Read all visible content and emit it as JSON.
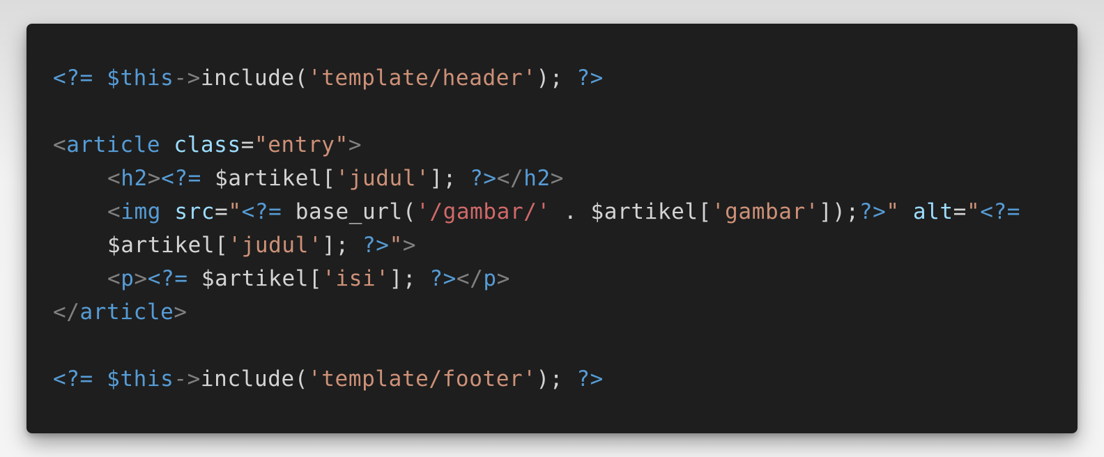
{
  "code_block": {
    "language": "php",
    "colors": {
      "background": "#1e1e1e",
      "keyword_tag": "#569cd6",
      "variable": "#9cdcfe",
      "string": "#ce9178",
      "punctuation": "#808080",
      "default": "#d4d4d4"
    },
    "lines": [
      {
        "indent": false,
        "tokens": [
          {
            "t": "<?=",
            "c": "phptag"
          },
          {
            "t": " ",
            "c": "default"
          },
          {
            "t": "$this",
            "c": "tag"
          },
          {
            "t": "->",
            "c": "punct"
          },
          {
            "t": "include(",
            "c": "default"
          },
          {
            "t": "'template/header'",
            "c": "str"
          },
          {
            "t": "); ",
            "c": "default"
          },
          {
            "t": "?>",
            "c": "phptag"
          }
        ]
      },
      {
        "indent": false,
        "tokens": []
      },
      {
        "indent": false,
        "tokens": [
          {
            "t": "<",
            "c": "punct"
          },
          {
            "t": "article",
            "c": "tag"
          },
          {
            "t": " ",
            "c": "default"
          },
          {
            "t": "class",
            "c": "attr"
          },
          {
            "t": "=",
            "c": "default"
          },
          {
            "t": "\"entry\"",
            "c": "str"
          },
          {
            "t": ">",
            "c": "punct"
          }
        ]
      },
      {
        "indent": true,
        "tokens": [
          {
            "t": "<",
            "c": "punct"
          },
          {
            "t": "h2",
            "c": "tag"
          },
          {
            "t": ">",
            "c": "punct"
          },
          {
            "t": "<?=",
            "c": "phptag"
          },
          {
            "t": " $artikel[",
            "c": "default"
          },
          {
            "t": "'judul'",
            "c": "str"
          },
          {
            "t": "]; ",
            "c": "default"
          },
          {
            "t": "?>",
            "c": "phptag"
          },
          {
            "t": "</",
            "c": "punct"
          },
          {
            "t": "h2",
            "c": "tag"
          },
          {
            "t": ">",
            "c": "punct"
          }
        ]
      },
      {
        "indent": true,
        "tokens": [
          {
            "t": "<",
            "c": "punct"
          },
          {
            "t": "img",
            "c": "tag"
          },
          {
            "t": " ",
            "c": "default"
          },
          {
            "t": "src",
            "c": "attr"
          },
          {
            "t": "=",
            "c": "default"
          },
          {
            "t": "\"",
            "c": "str"
          },
          {
            "t": "<?=",
            "c": "phptag"
          },
          {
            "t": " base_url(",
            "c": "default"
          },
          {
            "t": "'/gambar/'",
            "c": "str-red"
          },
          {
            "t": " . $artikel[",
            "c": "default"
          },
          {
            "t": "'gambar'",
            "c": "str"
          },
          {
            "t": "]);",
            "c": "default"
          },
          {
            "t": "?>",
            "c": "phptag"
          },
          {
            "t": "\"",
            "c": "str"
          },
          {
            "t": " ",
            "c": "default"
          },
          {
            "t": "alt",
            "c": "attr"
          },
          {
            "t": "=",
            "c": "default"
          },
          {
            "t": "\"",
            "c": "str"
          },
          {
            "t": "<?=",
            "c": "phptag"
          }
        ]
      },
      {
        "indent": true,
        "tokens": [
          {
            "t": "$artikel[",
            "c": "default"
          },
          {
            "t": "'judul'",
            "c": "str"
          },
          {
            "t": "]; ",
            "c": "default"
          },
          {
            "t": "?>",
            "c": "phptag"
          },
          {
            "t": "\"",
            "c": "str"
          },
          {
            "t": ">",
            "c": "punct"
          }
        ]
      },
      {
        "indent": true,
        "tokens": [
          {
            "t": "<",
            "c": "punct"
          },
          {
            "t": "p",
            "c": "tag"
          },
          {
            "t": ">",
            "c": "punct"
          },
          {
            "t": "<?=",
            "c": "phptag"
          },
          {
            "t": " $artikel[",
            "c": "default"
          },
          {
            "t": "'isi'",
            "c": "str"
          },
          {
            "t": "]; ",
            "c": "default"
          },
          {
            "t": "?>",
            "c": "phptag"
          },
          {
            "t": "</",
            "c": "punct"
          },
          {
            "t": "p",
            "c": "tag"
          },
          {
            "t": ">",
            "c": "punct"
          }
        ]
      },
      {
        "indent": false,
        "tokens": [
          {
            "t": "</",
            "c": "punct"
          },
          {
            "t": "article",
            "c": "tag"
          },
          {
            "t": ">",
            "c": "punct"
          }
        ]
      },
      {
        "indent": false,
        "tokens": []
      },
      {
        "indent": false,
        "tokens": [
          {
            "t": "<?=",
            "c": "phptag"
          },
          {
            "t": " ",
            "c": "default"
          },
          {
            "t": "$this",
            "c": "tag"
          },
          {
            "t": "->",
            "c": "punct"
          },
          {
            "t": "include(",
            "c": "default"
          },
          {
            "t": "'template/footer'",
            "c": "str"
          },
          {
            "t": "); ",
            "c": "default"
          },
          {
            "t": "?>",
            "c": "phptag"
          }
        ]
      }
    ]
  }
}
